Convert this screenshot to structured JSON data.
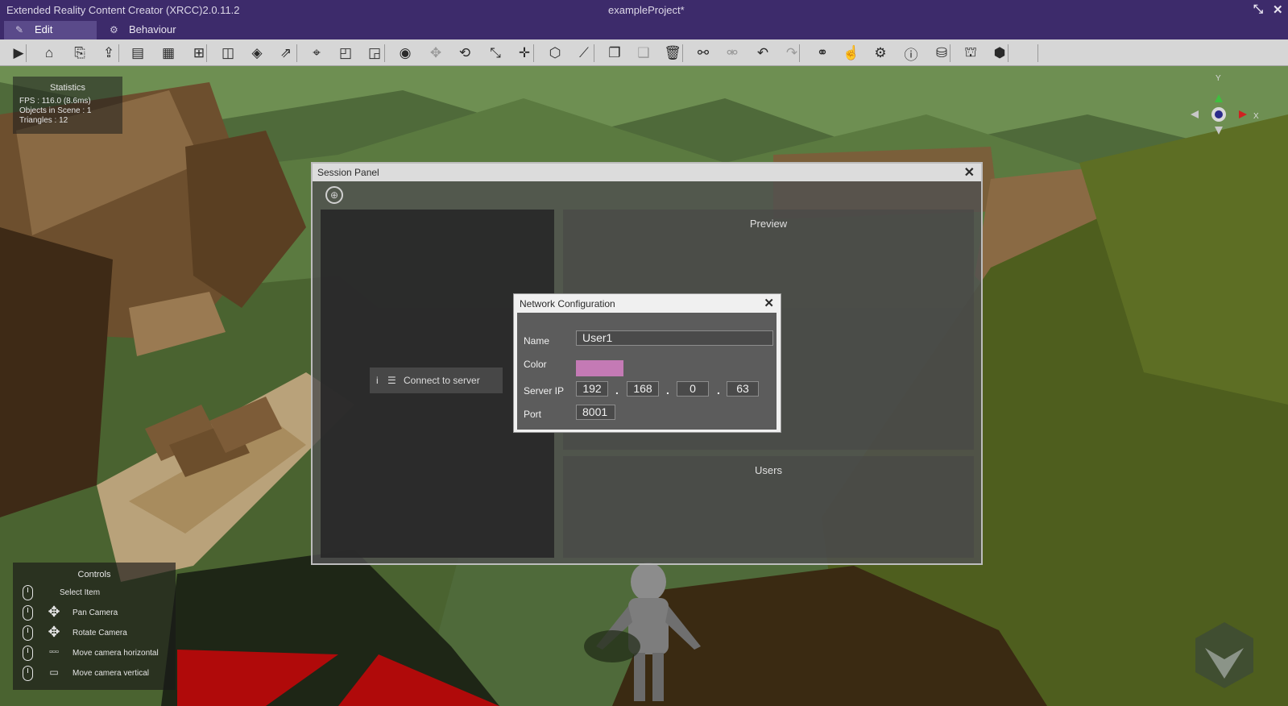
{
  "window": {
    "app_title": "Extended Reality Content Creator (XRCC)2.0.11.2",
    "project_title": "exampleProject*",
    "restore_icon": "restore-icon",
    "close_icon": "close-icon"
  },
  "tabs": [
    {
      "label": "Edit",
      "icon": "edit-icon",
      "active": true
    },
    {
      "label": "Behaviour",
      "icon": "gear-icon",
      "active": false
    }
  ],
  "toolbar": {
    "tools": [
      {
        "name": "play-icon",
        "glyph": "▶",
        "enabled": true
      },
      {
        "name": "home-icon",
        "glyph": "⌂",
        "enabled": true
      },
      {
        "name": "new-scene-icon",
        "glyph": "⎘",
        "enabled": true
      },
      {
        "name": "open-icon",
        "glyph": "⇪",
        "enabled": true
      },
      {
        "name": "save-icon",
        "glyph": "▤",
        "enabled": true
      },
      {
        "name": "save-as-icon",
        "glyph": "▦",
        "enabled": true
      },
      {
        "name": "hierarchy-icon",
        "glyph": "⊞",
        "enabled": true
      },
      {
        "name": "asset-box-icon",
        "glyph": "◫",
        "enabled": true
      },
      {
        "name": "asset-import-icon",
        "glyph": "◈",
        "enabled": true
      },
      {
        "name": "export-icon",
        "glyph": "⇗",
        "enabled": true
      },
      {
        "name": "location-list-icon",
        "glyph": "⌖",
        "enabled": true
      },
      {
        "name": "cube-outline-icon",
        "glyph": "◰",
        "enabled": true
      },
      {
        "name": "cube-add-icon",
        "glyph": "◲",
        "enabled": true
      },
      {
        "name": "view-icon",
        "glyph": "◉",
        "enabled": true
      },
      {
        "name": "move-icon",
        "glyph": "✥",
        "enabled": false
      },
      {
        "name": "rotate-icon",
        "glyph": "⟲",
        "enabled": true
      },
      {
        "name": "scale-icon",
        "glyph": "⤡",
        "enabled": true
      },
      {
        "name": "transform-icon",
        "glyph": "✛",
        "enabled": true
      },
      {
        "name": "bounds-icon",
        "glyph": "⬡",
        "enabled": true
      },
      {
        "name": "measure-icon",
        "glyph": "⟋",
        "enabled": true
      },
      {
        "name": "copy-icon",
        "glyph": "❐",
        "enabled": true
      },
      {
        "name": "paste-icon",
        "glyph": "❑",
        "enabled": false
      },
      {
        "name": "delete-icon",
        "glyph": "🗑",
        "enabled": true
      },
      {
        "name": "link-icon",
        "glyph": "⚯",
        "enabled": true
      },
      {
        "name": "unlink-icon",
        "glyph": "⚮",
        "enabled": false
      },
      {
        "name": "undo-icon",
        "glyph": "↶",
        "enabled": true
      },
      {
        "name": "redo-icon",
        "glyph": "↷",
        "enabled": false
      },
      {
        "name": "share-icon",
        "glyph": "⚭",
        "enabled": true
      },
      {
        "name": "interaction-help-icon",
        "glyph": "☝",
        "enabled": true
      },
      {
        "name": "settings-icon",
        "glyph": "⚙",
        "enabled": true
      },
      {
        "name": "info-icon",
        "glyph": "ⓘ",
        "enabled": true
      },
      {
        "name": "server-settings-icon",
        "glyph": "⛁",
        "enabled": true
      },
      {
        "name": "network-users-icon",
        "glyph": "⛫",
        "enabled": true
      },
      {
        "name": "unity-icon",
        "glyph": "⬢",
        "enabled": true
      }
    ]
  },
  "statistics": {
    "title": "Statistics",
    "fps": "FPS : 116.0 (8.6ms)",
    "objects": "Objects in Scene : 1",
    "triangles": "Triangles : 12"
  },
  "controls": {
    "title": "Controls",
    "items": [
      {
        "label": "Select Item",
        "icon": "mouse-left-icon",
        "extra": ""
      },
      {
        "label": "Pan Camera",
        "icon": "mouse-middle-icon",
        "extra": "move-arrows-icon"
      },
      {
        "label": "Rotate Camera",
        "icon": "mouse-right-icon",
        "extra": "move-arrows-icon"
      },
      {
        "label": "Move camera horizontal",
        "icon": "mouse-icon",
        "extra": "wasd-keys-icon"
      },
      {
        "label": "Move camera vertical",
        "icon": "mouse-icon",
        "extra": "spacebar-icon"
      }
    ]
  },
  "gizmo": {
    "y": "Y",
    "x": "X"
  },
  "session_panel": {
    "title": "Session Panel",
    "connect_label": "Connect to server",
    "preview_title": "Preview",
    "users_title": "Users"
  },
  "network_config": {
    "title": "Network Configuration",
    "name_label": "Name",
    "name_value": "User1",
    "color_label": "Color",
    "color_value": "#c47ab5",
    "server_ip_label": "Server IP",
    "ip": [
      "192",
      "168",
      "0",
      "63"
    ],
    "port_label": "Port",
    "port_value": "8001"
  }
}
